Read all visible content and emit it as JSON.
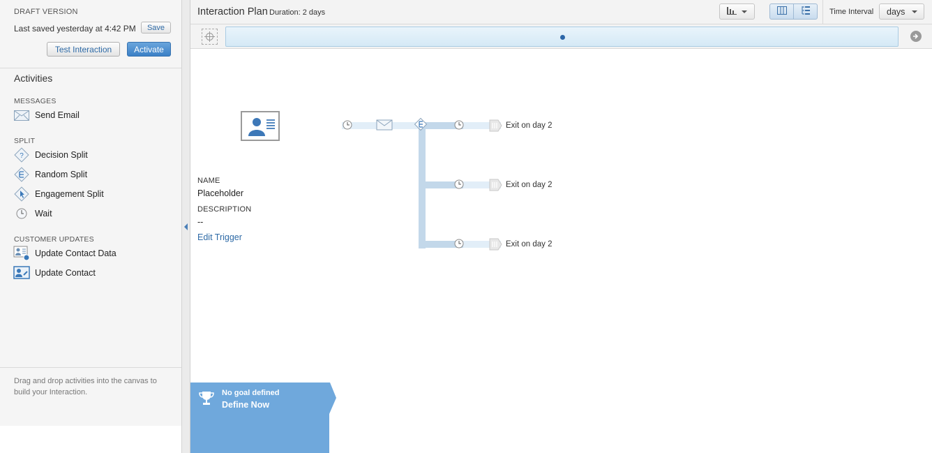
{
  "sidebar": {
    "draft_label": "DRAFT VERSION",
    "last_saved": "Last saved yesterday at 4:42 PM",
    "save_label": "Save",
    "test_label": "Test Interaction",
    "activate_label": "Activate",
    "activities_title": "Activities",
    "sections": [
      {
        "label": "MESSAGES",
        "items": [
          {
            "label": "Send Email",
            "icon": "envelope-icon"
          }
        ]
      },
      {
        "label": "SPLIT",
        "items": [
          {
            "label": "Decision Split",
            "icon": "decision-split-icon"
          },
          {
            "label": "Random Split",
            "icon": "random-split-icon"
          },
          {
            "label": "Engagement Split",
            "icon": "engagement-split-icon"
          },
          {
            "label": "Wait",
            "icon": "clock-icon"
          }
        ]
      },
      {
        "label": "CUSTOMER UPDATES",
        "items": [
          {
            "label": "Update Contact Data",
            "icon": "update-contact-data-icon"
          },
          {
            "label": "Update Contact",
            "icon": "update-contact-icon"
          }
        ]
      }
    ],
    "help_text": "Drag and drop activities into the canvas to build your Interaction."
  },
  "toolbar": {
    "title": "Interaction Plan",
    "duration": "Duration: 2 days",
    "time_interval_label": "Time Interval",
    "time_interval_value": "days"
  },
  "entry": {
    "name_label": "NAME",
    "name_value": "Placeholder",
    "description_label": "DESCRIPTION",
    "description_value": "--",
    "edit_trigger": "Edit Trigger"
  },
  "flow": {
    "exits": [
      "Exit on day 2",
      "Exit on day 2",
      "Exit on day 2"
    ]
  },
  "goal": {
    "status": "No goal defined",
    "action": "Define Now"
  },
  "colors": {
    "accent": "#3b80c6",
    "link": "#2e6aa6",
    "path": "#c3d8ea",
    "goal_panel": "#6fa8dc"
  }
}
